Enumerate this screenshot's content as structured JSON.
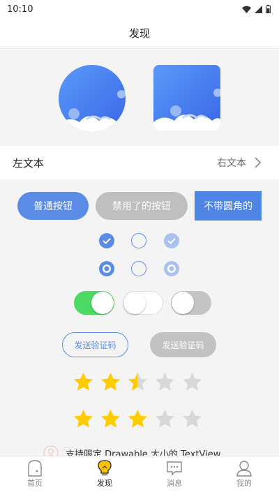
{
  "status_bar": {
    "time": "10:10"
  },
  "header": {
    "title": "发现"
  },
  "text_row": {
    "left": "左文本",
    "right": "右文本"
  },
  "buttons": {
    "normal": "普通按钮",
    "disabled": "禁用了的按钮",
    "square": "不带圆角的"
  },
  "checkboxes": [
    {
      "state": "checked"
    },
    {
      "state": "unchecked"
    },
    {
      "state": "checked-disabled"
    }
  ],
  "radios": [
    {
      "state": "selected"
    },
    {
      "state": "unselected"
    },
    {
      "state": "selected-disabled"
    }
  ],
  "switches": [
    {
      "state": "on"
    },
    {
      "state": "off"
    },
    {
      "state": "off-disabled"
    }
  ],
  "code_buttons": {
    "enabled": "发送验证码",
    "disabled": "发送验证码"
  },
  "ratings": [
    {
      "value": 2.5,
      "max": 5
    },
    {
      "value": 3,
      "max": 5
    }
  ],
  "drawable_text": "支持限定 Drawable 大小的 TextView",
  "tabs": [
    {
      "label": "首页",
      "icon": "home-icon",
      "active": false
    },
    {
      "label": "发现",
      "icon": "bulb-icon",
      "active": true
    },
    {
      "label": "消息",
      "icon": "message-icon",
      "active": false
    },
    {
      "label": "我的",
      "icon": "user-icon",
      "active": false
    }
  ],
  "colors": {
    "accent": "#5a8be6",
    "switch_on": "#4cd964",
    "star": "#ffcc00",
    "star_empty": "#d8d8d8",
    "disabled": "#bfbfbf"
  }
}
